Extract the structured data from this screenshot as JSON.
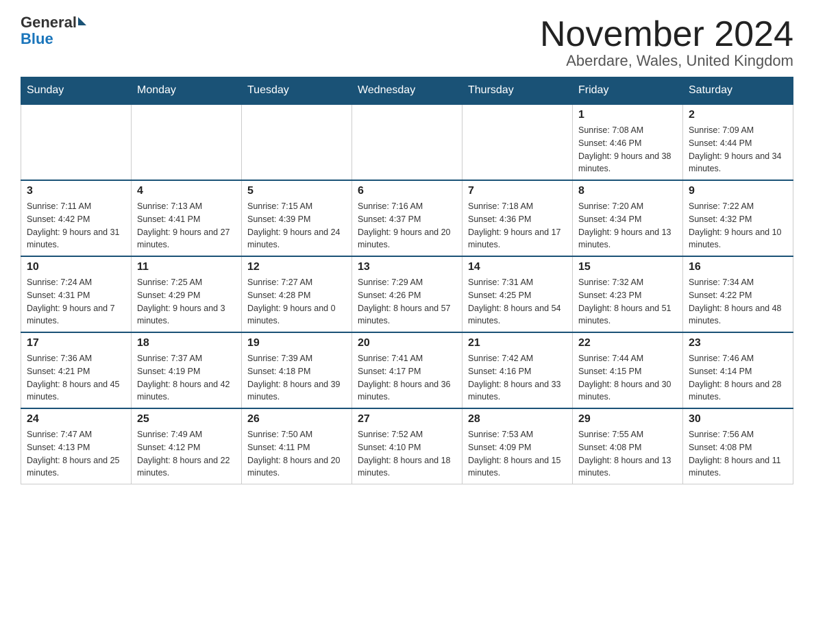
{
  "header": {
    "logo_general": "General",
    "logo_blue": "Blue",
    "month_title": "November 2024",
    "location": "Aberdare, Wales, United Kingdom"
  },
  "days_of_week": [
    "Sunday",
    "Monday",
    "Tuesday",
    "Wednesday",
    "Thursday",
    "Friday",
    "Saturday"
  ],
  "weeks": [
    [
      {
        "day": "",
        "info": ""
      },
      {
        "day": "",
        "info": ""
      },
      {
        "day": "",
        "info": ""
      },
      {
        "day": "",
        "info": ""
      },
      {
        "day": "",
        "info": ""
      },
      {
        "day": "1",
        "info": "Sunrise: 7:08 AM\nSunset: 4:46 PM\nDaylight: 9 hours and 38 minutes."
      },
      {
        "day": "2",
        "info": "Sunrise: 7:09 AM\nSunset: 4:44 PM\nDaylight: 9 hours and 34 minutes."
      }
    ],
    [
      {
        "day": "3",
        "info": "Sunrise: 7:11 AM\nSunset: 4:42 PM\nDaylight: 9 hours and 31 minutes."
      },
      {
        "day": "4",
        "info": "Sunrise: 7:13 AM\nSunset: 4:41 PM\nDaylight: 9 hours and 27 minutes."
      },
      {
        "day": "5",
        "info": "Sunrise: 7:15 AM\nSunset: 4:39 PM\nDaylight: 9 hours and 24 minutes."
      },
      {
        "day": "6",
        "info": "Sunrise: 7:16 AM\nSunset: 4:37 PM\nDaylight: 9 hours and 20 minutes."
      },
      {
        "day": "7",
        "info": "Sunrise: 7:18 AM\nSunset: 4:36 PM\nDaylight: 9 hours and 17 minutes."
      },
      {
        "day": "8",
        "info": "Sunrise: 7:20 AM\nSunset: 4:34 PM\nDaylight: 9 hours and 13 minutes."
      },
      {
        "day": "9",
        "info": "Sunrise: 7:22 AM\nSunset: 4:32 PM\nDaylight: 9 hours and 10 minutes."
      }
    ],
    [
      {
        "day": "10",
        "info": "Sunrise: 7:24 AM\nSunset: 4:31 PM\nDaylight: 9 hours and 7 minutes."
      },
      {
        "day": "11",
        "info": "Sunrise: 7:25 AM\nSunset: 4:29 PM\nDaylight: 9 hours and 3 minutes."
      },
      {
        "day": "12",
        "info": "Sunrise: 7:27 AM\nSunset: 4:28 PM\nDaylight: 9 hours and 0 minutes."
      },
      {
        "day": "13",
        "info": "Sunrise: 7:29 AM\nSunset: 4:26 PM\nDaylight: 8 hours and 57 minutes."
      },
      {
        "day": "14",
        "info": "Sunrise: 7:31 AM\nSunset: 4:25 PM\nDaylight: 8 hours and 54 minutes."
      },
      {
        "day": "15",
        "info": "Sunrise: 7:32 AM\nSunset: 4:23 PM\nDaylight: 8 hours and 51 minutes."
      },
      {
        "day": "16",
        "info": "Sunrise: 7:34 AM\nSunset: 4:22 PM\nDaylight: 8 hours and 48 minutes."
      }
    ],
    [
      {
        "day": "17",
        "info": "Sunrise: 7:36 AM\nSunset: 4:21 PM\nDaylight: 8 hours and 45 minutes."
      },
      {
        "day": "18",
        "info": "Sunrise: 7:37 AM\nSunset: 4:19 PM\nDaylight: 8 hours and 42 minutes."
      },
      {
        "day": "19",
        "info": "Sunrise: 7:39 AM\nSunset: 4:18 PM\nDaylight: 8 hours and 39 minutes."
      },
      {
        "day": "20",
        "info": "Sunrise: 7:41 AM\nSunset: 4:17 PM\nDaylight: 8 hours and 36 minutes."
      },
      {
        "day": "21",
        "info": "Sunrise: 7:42 AM\nSunset: 4:16 PM\nDaylight: 8 hours and 33 minutes."
      },
      {
        "day": "22",
        "info": "Sunrise: 7:44 AM\nSunset: 4:15 PM\nDaylight: 8 hours and 30 minutes."
      },
      {
        "day": "23",
        "info": "Sunrise: 7:46 AM\nSunset: 4:14 PM\nDaylight: 8 hours and 28 minutes."
      }
    ],
    [
      {
        "day": "24",
        "info": "Sunrise: 7:47 AM\nSunset: 4:13 PM\nDaylight: 8 hours and 25 minutes."
      },
      {
        "day": "25",
        "info": "Sunrise: 7:49 AM\nSunset: 4:12 PM\nDaylight: 8 hours and 22 minutes."
      },
      {
        "day": "26",
        "info": "Sunrise: 7:50 AM\nSunset: 4:11 PM\nDaylight: 8 hours and 20 minutes."
      },
      {
        "day": "27",
        "info": "Sunrise: 7:52 AM\nSunset: 4:10 PM\nDaylight: 8 hours and 18 minutes."
      },
      {
        "day": "28",
        "info": "Sunrise: 7:53 AM\nSunset: 4:09 PM\nDaylight: 8 hours and 15 minutes."
      },
      {
        "day": "29",
        "info": "Sunrise: 7:55 AM\nSunset: 4:08 PM\nDaylight: 8 hours and 13 minutes."
      },
      {
        "day": "30",
        "info": "Sunrise: 7:56 AM\nSunset: 4:08 PM\nDaylight: 8 hours and 11 minutes."
      }
    ]
  ]
}
